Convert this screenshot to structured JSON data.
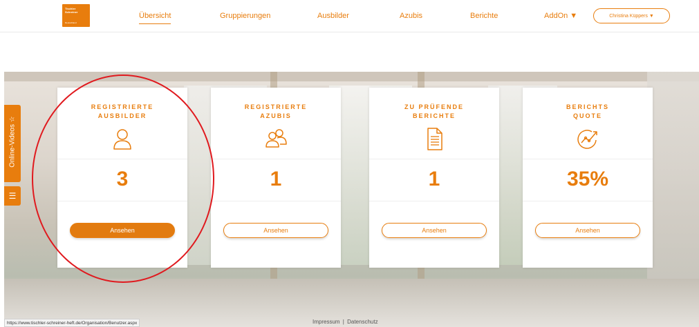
{
  "header": {
    "logo_line1": "Tischler",
    "logo_line2": "Schreiner",
    "logo_line3": "Deutschland",
    "nav": [
      {
        "label": "Übersicht",
        "active": true
      },
      {
        "label": "Gruppierungen",
        "active": false
      },
      {
        "label": "Ausbilder",
        "active": false
      },
      {
        "label": "Azubis",
        "active": false
      },
      {
        "label": "Berichte",
        "active": false
      },
      {
        "label": "AddOn ▼",
        "active": false
      }
    ],
    "user_label": "Christina Küppers ▼"
  },
  "side": {
    "videos_label": "Online-Videos ☆",
    "menu_icon": "☰"
  },
  "cards": [
    {
      "title_line1": "REGISTRIERTE",
      "title_line2": "AUSBILDER",
      "icon": "user-icon",
      "value": "3",
      "button": "Ansehen",
      "filled": true
    },
    {
      "title_line1": "REGISTRIERTE",
      "title_line2": "AZUBIS",
      "icon": "users-icon",
      "value": "1",
      "button": "Ansehen",
      "filled": false
    },
    {
      "title_line1": "ZU PRÜFENDE",
      "title_line2": "BERICHTE",
      "icon": "document-icon",
      "value": "1",
      "button": "Ansehen",
      "filled": false
    },
    {
      "title_line1": "BERICHTS",
      "title_line2": "QUOTE",
      "icon": "chart-icon",
      "value": "35%",
      "button": "Ansehen",
      "filled": false
    }
  ],
  "footer": {
    "impressum": "Impressum",
    "separator": "|",
    "datenschutz": "Datenschutz",
    "status_url": "https://www.tischler-schreiner-heft.de/Organisation/Benutzer.aspx"
  },
  "colors": {
    "accent": "#e87d0d",
    "annotation": "#e0191e"
  }
}
